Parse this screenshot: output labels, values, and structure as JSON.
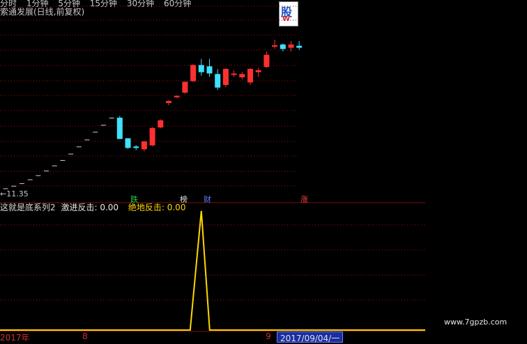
{
  "toolbar": {
    "tabs": [
      "分时",
      "1分钟",
      "5分钟",
      "15分钟",
      "30分钟",
      "60分钟"
    ]
  },
  "chart_title": "索通发展(日线,前复权)",
  "logo": {
    "top": "股",
    "bottom": "W"
  },
  "price_label": "←11.35",
  "event_tags": {
    "die": "跌",
    "bang": "榜",
    "cai": "财",
    "zhang": "涨"
  },
  "indicator": {
    "name": "这就是底系列2",
    "label1": "激进反击: 0.00",
    "label2": "绝地反击: 0.00"
  },
  "bottom": {
    "year": "2017年",
    "month_left": "8",
    "month_right": "9",
    "date_cursor": "2017/09/04/一"
  },
  "watermark": "www.7gpzb.com",
  "colors": {
    "up": "#ff3030",
    "down": "#40e0ff",
    "grid": "#a01010",
    "indicator": "#ffd700"
  },
  "chart_data": [
    {
      "type": "candlestick",
      "title": "索通发展(日线,前复权)",
      "note": "daily candles; price scale not printed except latest low marker 11.35",
      "candles": [
        {
          "o": 11.35,
          "h": 11.35,
          "l": 11.35,
          "c": 11.35
        },
        {
          "o": 11.45,
          "h": 11.45,
          "l": 11.45,
          "c": 11.45
        },
        {
          "o": 11.55,
          "h": 11.55,
          "l": 11.55,
          "c": 11.55
        },
        {
          "o": 11.7,
          "h": 11.7,
          "l": 11.7,
          "c": 11.7
        },
        {
          "o": 11.86,
          "h": 11.86,
          "l": 11.86,
          "c": 11.86
        },
        {
          "o": 12.04,
          "h": 12.04,
          "l": 12.04,
          "c": 12.04
        },
        {
          "o": 12.24,
          "h": 12.24,
          "l": 12.24,
          "c": 12.24
        },
        {
          "o": 12.45,
          "h": 12.45,
          "l": 12.45,
          "c": 12.45
        },
        {
          "o": 12.7,
          "h": 12.7,
          "l": 12.7,
          "c": 12.7
        },
        {
          "o": 12.98,
          "h": 12.98,
          "l": 12.98,
          "c": 12.98
        },
        {
          "o": 13.25,
          "h": 13.25,
          "l": 13.25,
          "c": 13.25
        },
        {
          "o": 13.55,
          "h": 13.55,
          "l": 13.55,
          "c": 13.55
        },
        {
          "o": 13.82,
          "h": 13.82,
          "l": 13.82,
          "c": 13.82
        },
        {
          "o": 14.1,
          "h": 14.1,
          "l": 14.1,
          "c": 14.1
        },
        {
          "o": 14.1,
          "h": 14.18,
          "l": 13.28,
          "c": 13.3
        },
        {
          "o": 13.3,
          "h": 13.32,
          "l": 12.9,
          "c": 12.95
        },
        {
          "o": 12.98,
          "h": 13.05,
          "l": 12.85,
          "c": 12.95
        },
        {
          "o": 12.9,
          "h": 13.2,
          "l": 12.8,
          "c": 13.18
        },
        {
          "o": 13.05,
          "h": 13.75,
          "l": 13.0,
          "c": 13.7
        },
        {
          "o": 13.75,
          "h": 14.05,
          "l": 13.7,
          "c": 14.0
        },
        {
          "o": 14.7,
          "h": 14.8,
          "l": 14.6,
          "c": 14.75
        },
        {
          "o": 14.92,
          "h": 14.98,
          "l": 14.88,
          "c": 14.95
        },
        {
          "o": 15.1,
          "h": 15.5,
          "l": 15.05,
          "c": 15.5
        },
        {
          "o": 15.55,
          "h": 16.2,
          "l": 15.5,
          "c": 16.15
        },
        {
          "o": 16.15,
          "h": 16.4,
          "l": 15.75,
          "c": 15.9
        },
        {
          "o": 16.1,
          "h": 16.4,
          "l": 15.7,
          "c": 15.85
        },
        {
          "o": 15.8,
          "h": 16.0,
          "l": 15.2,
          "c": 15.3
        },
        {
          "o": 15.4,
          "h": 16.05,
          "l": 15.3,
          "c": 16.0
        },
        {
          "o": 15.8,
          "h": 15.95,
          "l": 15.7,
          "c": 15.82
        },
        {
          "o": 15.7,
          "h": 15.9,
          "l": 15.6,
          "c": 15.8
        },
        {
          "o": 15.5,
          "h": 16.05,
          "l": 15.4,
          "c": 16.0
        },
        {
          "o": 15.9,
          "h": 16.05,
          "l": 15.7,
          "c": 15.95
        },
        {
          "o": 16.1,
          "h": 16.7,
          "l": 16.05,
          "c": 16.55
        },
        {
          "o": 16.9,
          "h": 17.15,
          "l": 16.8,
          "c": 16.92
        },
        {
          "o": 16.95,
          "h": 17.0,
          "l": 16.7,
          "c": 16.8
        },
        {
          "o": 16.85,
          "h": 17.1,
          "l": 16.7,
          "c": 16.95
        },
        {
          "o": 16.9,
          "h": 17.1,
          "l": 16.75,
          "c": 16.85
        }
      ]
    },
    {
      "type": "line",
      "title": "这就是底系列2",
      "series": [
        {
          "name": "激进反击",
          "values": [
            0,
            0,
            0,
            0,
            0,
            0,
            0,
            0,
            0,
            0,
            0,
            0,
            0,
            0,
            0,
            0,
            0,
            0,
            0,
            0,
            0,
            0,
            0,
            0,
            0,
            0,
            0,
            0,
            0,
            0,
            0,
            0,
            0,
            0,
            0,
            0,
            0
          ]
        },
        {
          "name": "绝地反击",
          "values": [
            0,
            0,
            0,
            0,
            0,
            0,
            0,
            0,
            0,
            0,
            0,
            0,
            0,
            0,
            0,
            0,
            0,
            0,
            0,
            0,
            0,
            0,
            0,
            0,
            0,
            0,
            0,
            0,
            0,
            0,
            0,
            0,
            0,
            0,
            0,
            0,
            0
          ]
        }
      ],
      "indicator_spike_values": [
        0,
        0,
        0,
        0,
        0,
        0,
        0,
        0,
        0,
        0,
        0,
        0,
        0,
        0,
        0,
        0,
        0,
        0,
        0,
        0,
        0,
        0,
        0,
        0,
        1,
        0,
        0,
        0,
        0,
        0,
        0,
        0,
        0,
        0,
        0,
        0,
        0
      ]
    }
  ]
}
